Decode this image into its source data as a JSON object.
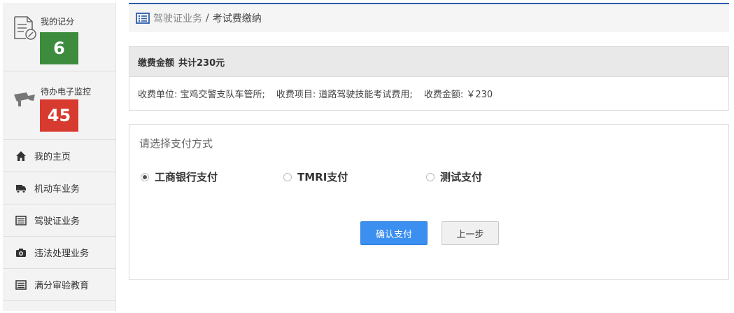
{
  "sidebar": {
    "cards": [
      {
        "label": "我的记分",
        "count": "6",
        "icon": "document-edit-icon",
        "color": "#3d8b3d"
      },
      {
        "label": "待办电子监控",
        "count": "45",
        "icon": "surveillance-camera-icon",
        "color": "#d73b2f"
      }
    ],
    "items": [
      {
        "label": "我的主页",
        "icon": "home-icon"
      },
      {
        "label": "机动车业务",
        "icon": "truck-icon"
      },
      {
        "label": "驾驶证业务",
        "icon": "list-icon"
      },
      {
        "label": "违法处理业务",
        "icon": "camera-icon"
      },
      {
        "label": "满分审验教育",
        "icon": "list-icon"
      }
    ]
  },
  "breadcrumb": {
    "icon": "list-icon",
    "parent": "驾驶证业务",
    "separator": "/",
    "current": "考试费缴纳"
  },
  "fee_panel": {
    "title": "缴费金额",
    "total": "共计230元",
    "items": [
      "收费单位: 宝鸡交警支队车管所;",
      "收费项目: 道路驾驶技能考试费用;",
      "收费金额: ￥230"
    ]
  },
  "payment_panel": {
    "title": "请选择支付方式",
    "options": [
      {
        "label": "工商银行支付",
        "selected": true
      },
      {
        "label": "TMRI支付",
        "selected": false
      },
      {
        "label": "测试支付",
        "selected": false
      }
    ],
    "confirm_label": "确认支付",
    "back_label": "上一步"
  },
  "colors": {
    "accent": "#2a5caa",
    "primary_button": "#3b8ff0",
    "badge_green": "#3d8b3d",
    "badge_red": "#d73b2f"
  }
}
